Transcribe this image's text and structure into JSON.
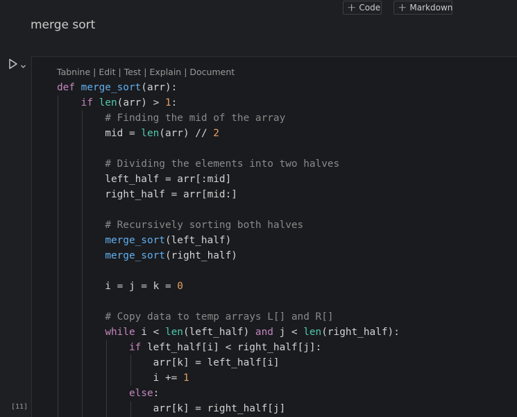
{
  "toolbar": {
    "add_code_label": "Code",
    "add_markdown_label": "Markdown",
    "plus_glyph": "+"
  },
  "markdown_cell": {
    "text": "merge sort"
  },
  "code_cell": {
    "execution_count": "[11]",
    "codelens": "Tabnine | Edit | Test | Explain | Document",
    "lines": [
      [
        [
          "kw",
          "def "
        ],
        [
          "fn",
          "merge_sort"
        ],
        [
          "var",
          "(arr):"
        ]
      ],
      [
        [
          "var",
          "    "
        ],
        [
          "kw",
          "if "
        ],
        [
          "bi",
          "len"
        ],
        [
          "var",
          "(arr) "
        ],
        [
          "op",
          "> "
        ],
        [
          "num",
          "1"
        ],
        [
          "var",
          ":"
        ]
      ],
      [
        [
          "var",
          "        "
        ],
        [
          "cm",
          "# Finding the mid of the array"
        ]
      ],
      [
        [
          "var",
          "        mid "
        ],
        [
          "op",
          "= "
        ],
        [
          "bi",
          "len"
        ],
        [
          "var",
          "(arr) "
        ],
        [
          "op",
          "// "
        ],
        [
          "num",
          "2"
        ]
      ],
      [
        [
          "var",
          ""
        ]
      ],
      [
        [
          "var",
          "        "
        ],
        [
          "cm",
          "# Dividing the elements into two halves"
        ]
      ],
      [
        [
          "var",
          "        left_half "
        ],
        [
          "op",
          "= "
        ],
        [
          "var",
          "arr[:mid]"
        ]
      ],
      [
        [
          "var",
          "        right_half "
        ],
        [
          "op",
          "= "
        ],
        [
          "var",
          "arr[mid:]"
        ]
      ],
      [
        [
          "var",
          ""
        ]
      ],
      [
        [
          "var",
          "        "
        ],
        [
          "cm",
          "# Recursively sorting both halves"
        ]
      ],
      [
        [
          "var",
          "        "
        ],
        [
          "fn",
          "merge_sort"
        ],
        [
          "var",
          "(left_half)"
        ]
      ],
      [
        [
          "var",
          "        "
        ],
        [
          "fn",
          "merge_sort"
        ],
        [
          "var",
          "(right_half)"
        ]
      ],
      [
        [
          "var",
          ""
        ]
      ],
      [
        [
          "var",
          "        i "
        ],
        [
          "op",
          "= "
        ],
        [
          "var",
          "j "
        ],
        [
          "op",
          "= "
        ],
        [
          "var",
          "k "
        ],
        [
          "op",
          "= "
        ],
        [
          "num",
          "0"
        ]
      ],
      [
        [
          "var",
          ""
        ]
      ],
      [
        [
          "var",
          "        "
        ],
        [
          "cm",
          "# Copy data to temp arrays L[] and R[]"
        ]
      ],
      [
        [
          "var",
          "        "
        ],
        [
          "kw",
          "while "
        ],
        [
          "var",
          "i "
        ],
        [
          "op",
          "< "
        ],
        [
          "bi",
          "len"
        ],
        [
          "var",
          "(left_half) "
        ],
        [
          "kw",
          "and "
        ],
        [
          "var",
          "j "
        ],
        [
          "op",
          "< "
        ],
        [
          "bi",
          "len"
        ],
        [
          "var",
          "(right_half):"
        ]
      ],
      [
        [
          "var",
          "            "
        ],
        [
          "kw",
          "if "
        ],
        [
          "var",
          "left_half[i] "
        ],
        [
          "op",
          "< "
        ],
        [
          "var",
          "right_half[j]:"
        ]
      ],
      [
        [
          "var",
          "                arr[k] "
        ],
        [
          "op",
          "= "
        ],
        [
          "var",
          "left_half[i]"
        ]
      ],
      [
        [
          "var",
          "                i "
        ],
        [
          "op",
          "+= "
        ],
        [
          "num",
          "1"
        ]
      ],
      [
        [
          "var",
          "            "
        ],
        [
          "kw",
          "else"
        ],
        [
          "var",
          ":"
        ]
      ],
      [
        [
          "var",
          "                arr[k] "
        ],
        [
          "op",
          "= "
        ],
        [
          "var",
          "right_half[j]"
        ]
      ]
    ]
  },
  "colors": {
    "background": "#1e1f22",
    "keyword": "#c586c0",
    "function": "#61afef",
    "builtin": "#4ec9b0",
    "number": "#e5a366",
    "comment": "#8a8a8a"
  },
  "icons": {
    "run": "play-icon",
    "run_menu": "chevron-down-icon",
    "add": "plus-icon"
  }
}
